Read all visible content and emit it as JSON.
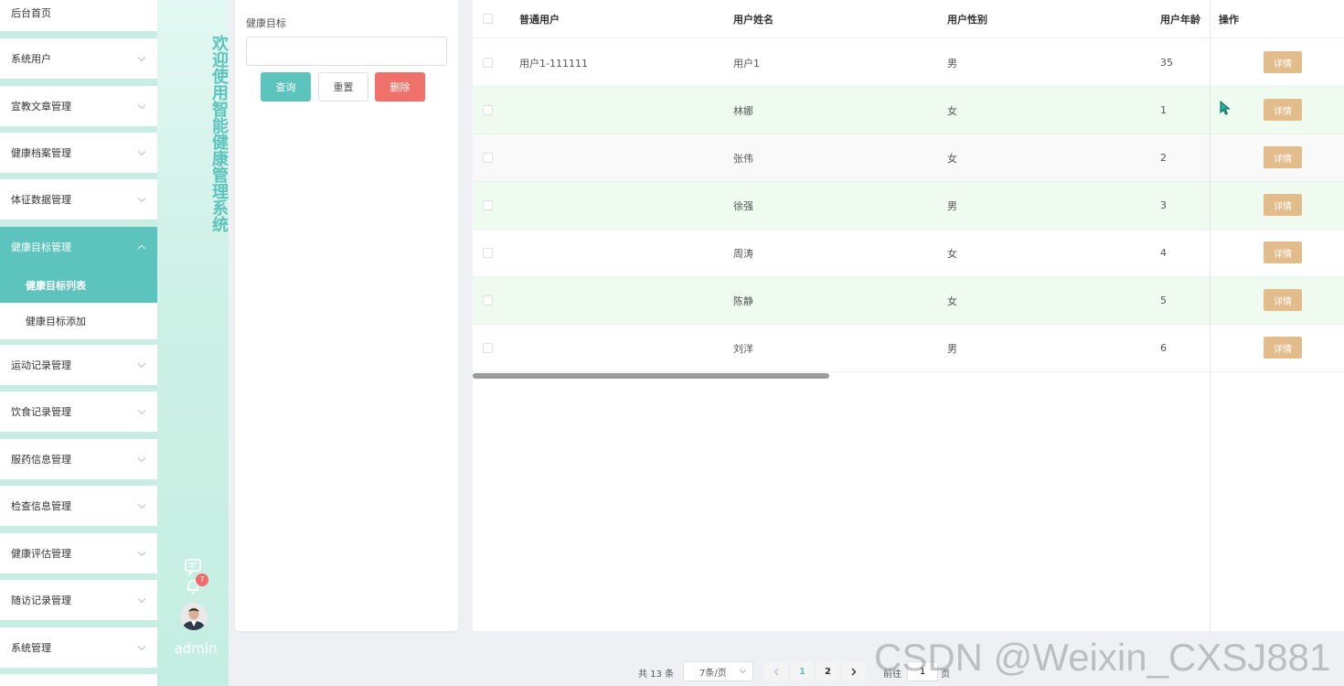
{
  "sidebar": {
    "items": [
      {
        "label": "后台首页"
      },
      {
        "label": "系统用户"
      },
      {
        "label": "宣教文章管理"
      },
      {
        "label": "健康档案管理"
      },
      {
        "label": "体征数据管理"
      },
      {
        "label": "健康目标管理"
      },
      {
        "label": "运动记录管理"
      },
      {
        "label": "饮食记录管理"
      },
      {
        "label": "服药信息管理"
      },
      {
        "label": "检查信息管理"
      },
      {
        "label": "健康评估管理"
      },
      {
        "label": "随访记录管理"
      },
      {
        "label": "系统管理"
      }
    ],
    "sub": {
      "list": "健康目标列表",
      "add": "健康目标添加"
    }
  },
  "banner": {
    "title": "欢迎使用智能健康管理系统",
    "badge": "7",
    "user": "admin",
    "icons": [
      "message-icon",
      "bell-icon",
      "avatar"
    ]
  },
  "search": {
    "label": "健康目标",
    "value": "",
    "query": "查询",
    "reset": "重置",
    "delete": "删除"
  },
  "table": {
    "columns": [
      "普通用户",
      "用户姓名",
      "用户性别",
      "用户年龄",
      "操作"
    ],
    "detail_label": "详情",
    "rows": [
      {
        "user": "用户1-111111",
        "name": "用户1",
        "gender": "男",
        "age": "35"
      },
      {
        "user": "",
        "name": "林娜",
        "gender": "女",
        "age": "1"
      },
      {
        "user": "",
        "name": "张伟",
        "gender": "女",
        "age": "2"
      },
      {
        "user": "",
        "name": "徐强",
        "gender": "男",
        "age": "3"
      },
      {
        "user": "",
        "name": "周涛",
        "gender": "女",
        "age": "4"
      },
      {
        "user": "",
        "name": "陈静",
        "gender": "女",
        "age": "5"
      },
      {
        "user": "",
        "name": "刘洋",
        "gender": "男",
        "age": "6"
      }
    ]
  },
  "pagination": {
    "total": "共 13 条",
    "page_size": "7条/页",
    "pages": [
      "1",
      "2"
    ],
    "goto_label": "前往",
    "goto_value": "1",
    "goto_suffix": "页"
  },
  "watermark": "CSDN @Weixin_CXSJ881",
  "colors": {
    "accent": "#5cc4bc",
    "danger": "#f0716a",
    "detail": "#e3bc8c"
  }
}
